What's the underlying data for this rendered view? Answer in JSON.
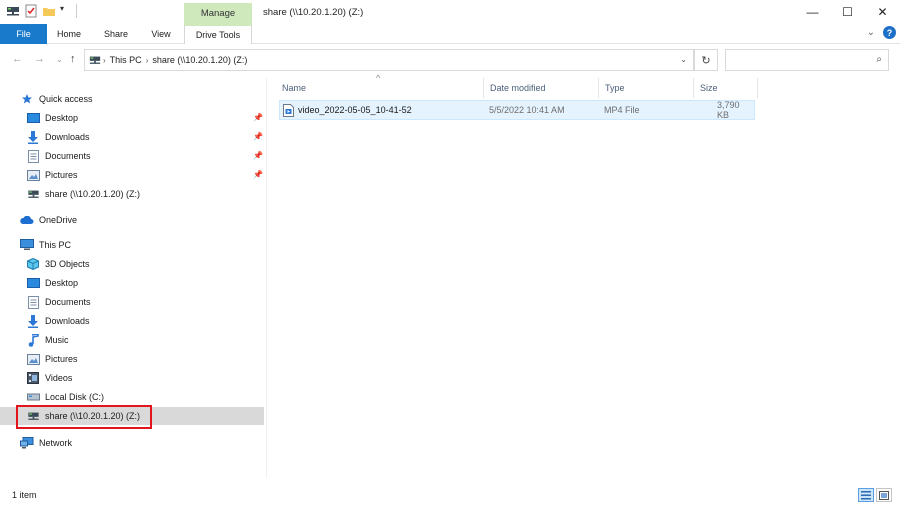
{
  "window": {
    "title": "share (\\\\10.20.1.20) (Z:)",
    "contextual_group": "Manage",
    "minimize": "—",
    "maximize": "☐",
    "close": "✕"
  },
  "ribbon": {
    "tabs": [
      {
        "label": "File"
      },
      {
        "label": "Home"
      },
      {
        "label": "Share"
      },
      {
        "label": "View"
      },
      {
        "label": "Drive Tools"
      }
    ],
    "collapse": "⌄",
    "help": "?"
  },
  "address": {
    "breadcrumbs": [
      "This PC",
      "share (\\\\10.20.1.20) (Z:)"
    ],
    "search_placeholder": ""
  },
  "nav": {
    "quick_access": "Quick access",
    "quick_items": [
      {
        "label": "Desktop",
        "icon": "desktop-icon"
      },
      {
        "label": "Downloads",
        "icon": "downloads-icon"
      },
      {
        "label": "Documents",
        "icon": "documents-icon"
      },
      {
        "label": "Pictures",
        "icon": "pictures-icon"
      },
      {
        "label": "share (\\\\10.20.1.20) (Z:)",
        "icon": "network-drive-icon"
      }
    ],
    "onedrive": "OneDrive",
    "this_pc": "This PC",
    "pc_items": [
      {
        "label": "3D Objects",
        "icon": "3d-objects-icon"
      },
      {
        "label": "Desktop",
        "icon": "desktop-icon"
      },
      {
        "label": "Documents",
        "icon": "documents-icon"
      },
      {
        "label": "Downloads",
        "icon": "downloads-icon"
      },
      {
        "label": "Music",
        "icon": "music-icon"
      },
      {
        "label": "Pictures",
        "icon": "pictures-icon"
      },
      {
        "label": "Videos",
        "icon": "videos-icon"
      },
      {
        "label": "Local Disk (C:)",
        "icon": "local-disk-icon"
      },
      {
        "label": "share (\\\\10.20.1.20) (Z:)",
        "icon": "network-drive-icon",
        "selected": true
      }
    ],
    "network": "Network"
  },
  "columns": {
    "name": "Name",
    "date": "Date modified",
    "type": "Type",
    "size": "Size"
  },
  "files": [
    {
      "name": "video_2022-05-05_10-41-52",
      "date": "5/5/2022 10:41 AM",
      "type": "MP4 File",
      "size": "3,790 KB"
    }
  ],
  "status": {
    "count": "1 item"
  },
  "colors": {
    "accent": "#1979ca",
    "manage_tab": "#cfe9bd",
    "selection": "#e5f3ff",
    "highlight": "#e3141a"
  }
}
